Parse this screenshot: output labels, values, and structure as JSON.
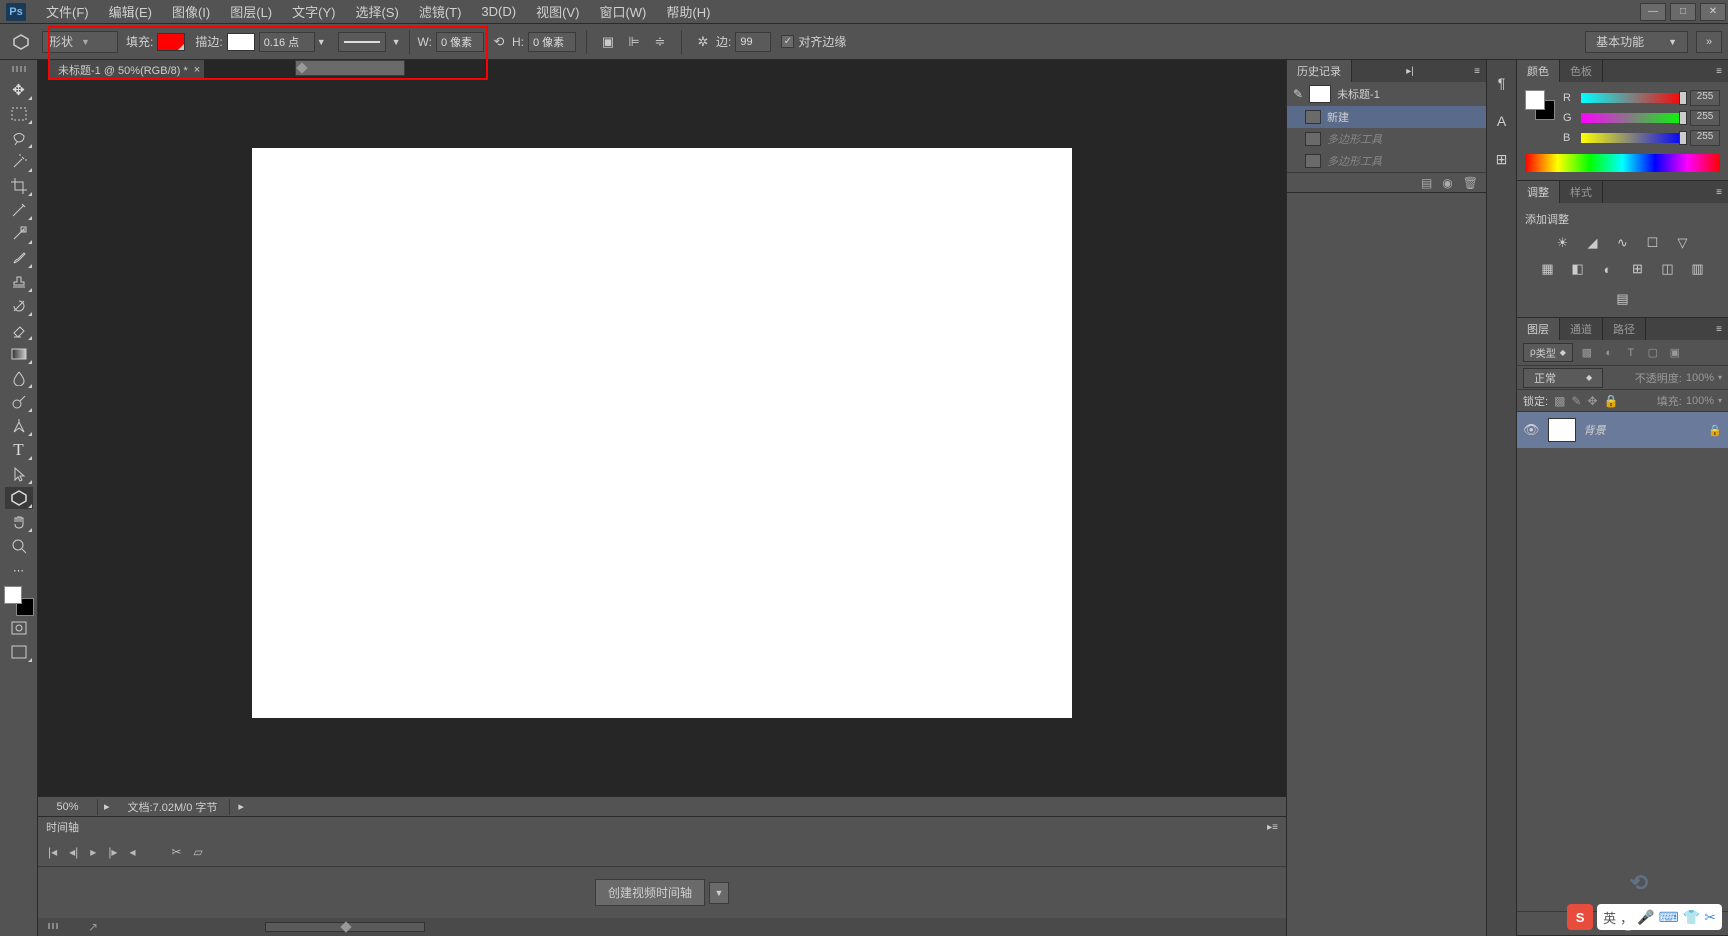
{
  "menu": {
    "items": [
      "文件(F)",
      "编辑(E)",
      "图像(I)",
      "图层(L)",
      "文字(Y)",
      "选择(S)",
      "滤镜(T)",
      "3D(D)",
      "视图(V)",
      "窗口(W)",
      "帮助(H)"
    ]
  },
  "options": {
    "shape_mode": "形状",
    "fill_label": "填充:",
    "stroke_label": "描边:",
    "stroke_width": "0.16 点",
    "w_label": "W:",
    "w_value": "0 像素",
    "h_label": "H:",
    "h_value": "0 像素",
    "sides_label": "边:",
    "sides_value": "99",
    "align_edges": "对齐边缘",
    "workspace": "基本功能"
  },
  "doc_tab": "未标题-1 @ 50%(RGB/8) *",
  "status": {
    "zoom": "50%",
    "docinfo": "文档:7.02M/0 字节"
  },
  "timeline": {
    "title": "时间轴",
    "create": "创建视频时间轴"
  },
  "history": {
    "title": "历史记录",
    "snapshot": "未标题-1",
    "items": [
      "新建",
      "多边形工具",
      "多边形工具"
    ]
  },
  "color": {
    "tab": "颜色",
    "tab2": "色板",
    "r_label": "R",
    "g_label": "G",
    "b_label": "B",
    "r": "255",
    "g": "255",
    "b": "255"
  },
  "adjust": {
    "tab": "调整",
    "tab2": "样式",
    "label": "添加调整"
  },
  "layers": {
    "tab": "图层",
    "tab2": "通道",
    "tab3": "路径",
    "kind": "类型",
    "mode": "正常",
    "opacity_label": "不透明度:",
    "opacity": "100%",
    "lock_label": "锁定:",
    "fill_label": "填充:",
    "fill": "100%",
    "layer_name": "背景"
  },
  "ime": {
    "lang": "英",
    "sep": "，"
  }
}
